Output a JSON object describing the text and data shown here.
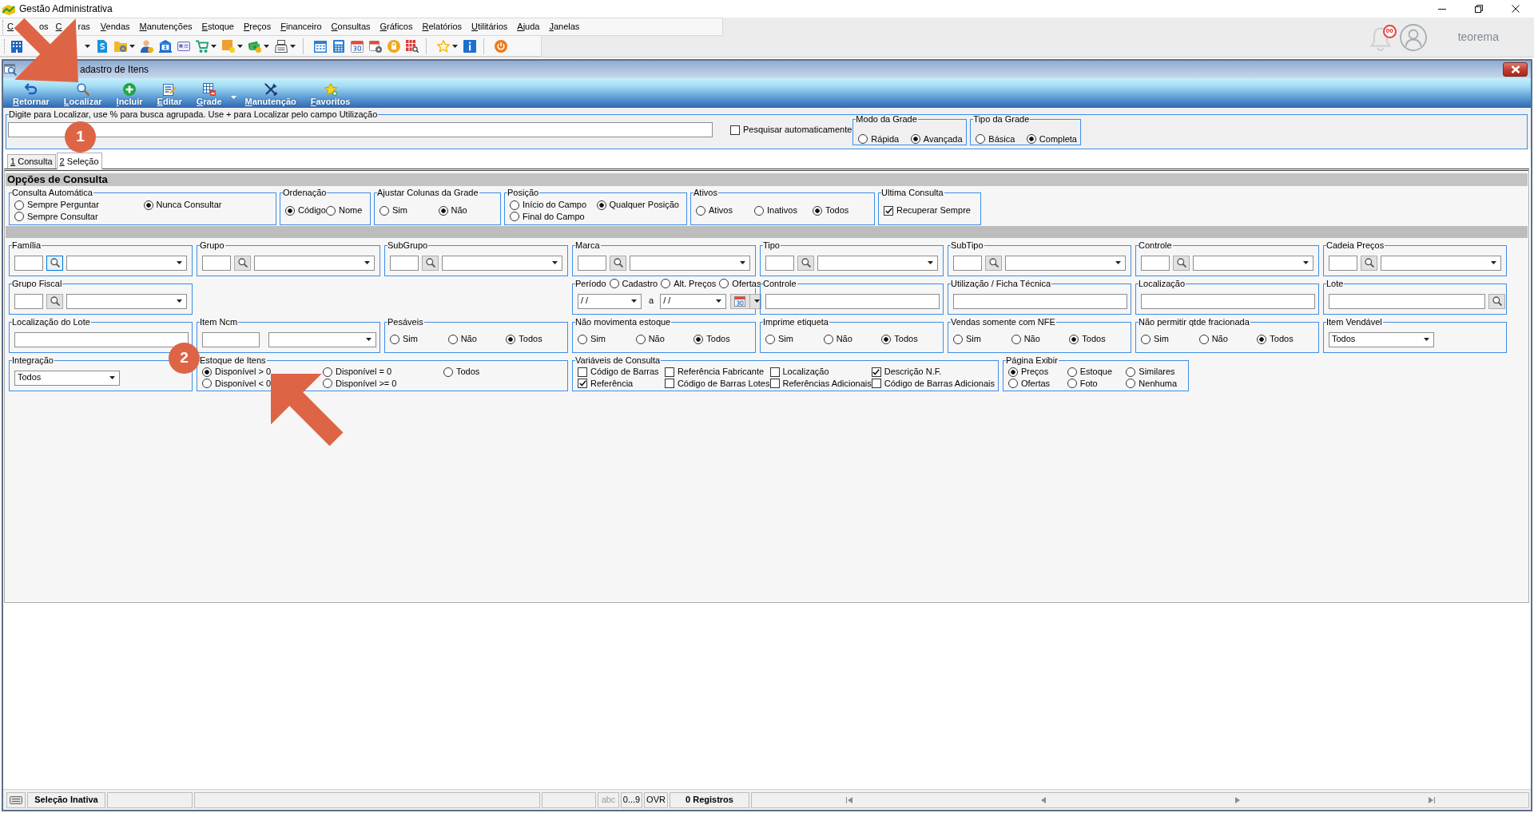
{
  "app": {
    "title": "Gestão Administrativa"
  },
  "menu": [
    "C",
    "os",
    "C",
    "ras",
    "Vendas",
    "Manutenções",
    "Estoque",
    "Preços",
    "Financeiro",
    "Consultas",
    "Gráficos",
    "Relatórios",
    "Utilitários",
    "Ajuda",
    "Janelas"
  ],
  "user": {
    "notifications": "00",
    "name": "teorema"
  },
  "window": {
    "title": "adastro de Itens"
  },
  "actions": [
    {
      "label": "Retornar",
      "has_menu": false
    },
    {
      "label": "Localizar",
      "has_menu": false
    },
    {
      "label": "Incluir",
      "has_menu": false
    },
    {
      "label": "Editar",
      "has_menu": false
    },
    {
      "label": "Grade",
      "has_menu": true
    },
    {
      "label": "Manutenção",
      "has_menu": false
    },
    {
      "label": "Favoritos",
      "has_menu": false
    }
  ],
  "search": {
    "label": "Digite para Localizar, use % para busca agrupada. Use + para Localizar pelo campo Utilização",
    "auto_search": {
      "label": "Pesquisar automaticamente",
      "checked": false
    },
    "groups": [
      {
        "title": "Modo da Grade",
        "options": [
          [
            {
              "label": "Rápida",
              "selected": false
            },
            {
              "label": "Avançada",
              "selected": true
            }
          ]
        ]
      },
      {
        "title": "Tipo da Grade",
        "options": [
          [
            {
              "label": "Básica",
              "selected": false
            },
            {
              "label": "Completa",
              "selected": true
            }
          ]
        ]
      }
    ]
  },
  "tabs": [
    {
      "label": "1 Consulta",
      "selected": false
    },
    {
      "label": "2 Seleção",
      "selected": true
    }
  ],
  "panel": {
    "title": "Opções de Consulta",
    "option_groups": [
      {
        "title": "Consulta Automática",
        "kind": "radio",
        "options": [
          [
            {
              "label": "Sempre Perguntar",
              "selected": false
            },
            {
              "label": "Nunca Consultar",
              "selected": true
            }
          ],
          [
            {
              "label": "Sempre Consultar",
              "selected": false
            }
          ]
        ]
      },
      {
        "title": "Ordenação",
        "kind": "radio",
        "options": [
          [
            {
              "label": "Código",
              "selected": true
            },
            {
              "label": "Nome",
              "selected": false
            }
          ]
        ]
      },
      {
        "title": "Ajustar Colunas da Grade",
        "kind": "radio",
        "options": [
          [
            {
              "label": "Sim",
              "selected": false
            },
            {
              "label": "Não",
              "selected": true
            }
          ]
        ]
      },
      {
        "title": "Posição",
        "kind": "radio",
        "options": [
          [
            {
              "label": "Início do Campo",
              "selected": false
            },
            {
              "label": "Qualquer Posição",
              "selected": true
            }
          ],
          [
            {
              "label": "Final do Campo",
              "selected": false
            }
          ]
        ]
      },
      {
        "title": "Ativos",
        "kind": "radio",
        "options": [
          [
            {
              "label": "Ativos",
              "selected": false
            },
            {
              "label": "Inativos",
              "selected": false
            },
            {
              "label": "Todos",
              "selected": true
            }
          ]
        ]
      },
      {
        "title": "Ultima Consulta",
        "kind": "check",
        "options": [
          [
            {
              "label": "Recuperar Sempre",
              "checked": true
            }
          ]
        ]
      }
    ],
    "filter_rows": [
      [
        {
          "title": "Família",
          "kind": "lookup",
          "highlighted": true
        },
        {
          "title": "Grupo",
          "kind": "lookup",
          "highlighted": false
        },
        {
          "title": "SubGrupo",
          "kind": "lookup",
          "highlighted": false
        },
        {
          "title": "Marca",
          "kind": "lookup",
          "highlighted": false
        },
        {
          "title": "Tipo",
          "kind": "lookup",
          "highlighted": false
        },
        {
          "title": "SubTipo",
          "kind": "lookup",
          "highlighted": false
        },
        {
          "title": "Controle",
          "kind": "lookup",
          "highlighted": false
        },
        {
          "title": "Cadeia Preços",
          "kind": "lookup",
          "highlighted": false
        }
      ],
      [
        {
          "title": "Grupo Fiscal",
          "kind": "lookup",
          "highlighted": false
        },
        {
          "title": "Período",
          "kind": "period",
          "options": [
            {
              "label": "Cadastro",
              "selected": false
            },
            {
              "label": "Alt. Preços",
              "selected": false
            },
            {
              "label": "Ofertas",
              "selected": false
            }
          ],
          "from": "/ /",
          "separator": "a",
          "to": "/ /"
        },
        {
          "title": "Controle",
          "kind": "input"
        },
        {
          "title": "Utilização / Ficha Técnica",
          "kind": "input"
        },
        {
          "title": "Localização",
          "kind": "input"
        },
        {
          "title": "Lote",
          "kind": "search_input"
        }
      ],
      [
        {
          "title": "Localização do Lote",
          "kind": "input"
        },
        {
          "title": "Item Ncm",
          "kind": "input_combo"
        },
        {
          "title": "Pesáveis",
          "kind": "radio",
          "options": [
            [
              {
                "label": "Sim",
                "selected": false
              },
              {
                "label": "Não",
                "selected": false
              },
              {
                "label": "Todos",
                "selected": true
              }
            ]
          ]
        },
        {
          "title": "Não movimenta estoque",
          "kind": "radio",
          "options": [
            [
              {
                "label": "Sim",
                "selected": false
              },
              {
                "label": "Não",
                "selected": false
              },
              {
                "label": "Todos",
                "selected": true
              }
            ]
          ]
        },
        {
          "title": "Imprime etiqueta",
          "kind": "radio",
          "options": [
            [
              {
                "label": "Sim",
                "selected": false
              },
              {
                "label": "Não",
                "selected": false
              },
              {
                "label": "Todos",
                "selected": true
              }
            ]
          ]
        },
        {
          "title": "Vendas somente com NFE",
          "kind": "radio",
          "options": [
            [
              {
                "label": "Sim",
                "selected": false
              },
              {
                "label": "Não",
                "selected": false
              },
              {
                "label": "Todos",
                "selected": true
              }
            ]
          ]
        },
        {
          "title": "Não permitir qtde fracionada",
          "kind": "radio",
          "options": [
            [
              {
                "label": "Sim",
                "selected": false
              },
              {
                "label": "Não",
                "selected": false
              },
              {
                "label": "Todos",
                "selected": true
              }
            ]
          ]
        },
        {
          "title": "Item Vendável",
          "kind": "combo",
          "value": "Todos"
        }
      ],
      [
        {
          "title": "Integração",
          "kind": "combo",
          "value": "Todos"
        },
        {
          "title": "Estoque de Itens",
          "kind": "radio",
          "options": [
            [
              {
                "label": "Disponível > 0",
                "selected": true
              },
              {
                "label": "Disponível = 0",
                "selected": false
              },
              {
                "label": "Todos",
                "selected": false
              }
            ],
            [
              {
                "label": "Disponível < 0",
                "selected": false
              },
              {
                "label": "Disponível >= 0",
                "selected": false
              }
            ]
          ]
        },
        {
          "title": "Variáveis de Consulta",
          "kind": "check",
          "options": [
            [
              {
                "label": "Código de Barras",
                "checked": false
              },
              {
                "label": "Referência Fabricante",
                "checked": false
              },
              {
                "label": "Localização",
                "checked": false
              },
              {
                "label": "Descrição N.F.",
                "checked": true
              }
            ],
            [
              {
                "label": "Referência",
                "checked": true
              },
              {
                "label": "Código de Barras Lotes",
                "checked": false
              },
              {
                "label": "Referências Adicionais",
                "checked": false
              },
              {
                "label": "Código de Barras Adicionais",
                "checked": false
              }
            ]
          ]
        },
        {
          "title": "Página Exibir",
          "kind": "radio",
          "options": [
            [
              {
                "label": "Preços",
                "selected": true
              },
              {
                "label": "Estoque",
                "selected": false
              },
              {
                "label": "Similares",
                "selected": false
              }
            ],
            [
              {
                "label": "Ofertas",
                "selected": false
              },
              {
                "label": "Foto",
                "selected": false
              },
              {
                "label": "Nenhuma",
                "selected": false
              }
            ]
          ]
        }
      ]
    ]
  },
  "status_bar": {
    "mode": "Seleção Inativa",
    "indicators": [
      {
        "label": "abc",
        "active": false
      },
      {
        "label": "0...9",
        "active": true
      },
      {
        "label": "OVR",
        "active": true
      }
    ],
    "records": "0 Registros"
  },
  "annotations": [
    {
      "kind": "arrow"
    },
    {
      "kind": "marker",
      "label": "1"
    },
    {
      "kind": "marker",
      "label": "2"
    },
    {
      "kind": "arrow"
    }
  ]
}
